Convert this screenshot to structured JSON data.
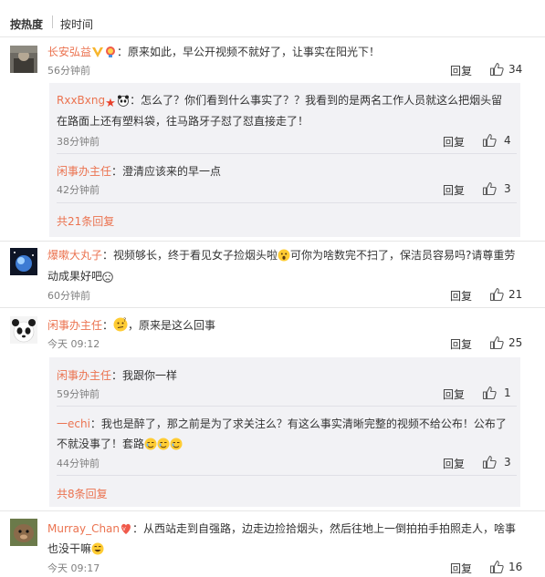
{
  "sort": {
    "hot": "按热度",
    "time": "按时间"
  },
  "labels": {
    "reply": "回复"
  },
  "comments": [
    {
      "user": "长安弘益",
      "text": "：原来如此，早公开视频不就好了，让事实在阳光下！",
      "time": "56分钟前",
      "likes": "34",
      "replies": [
        {
          "user": "RxxBxng",
          "text1": "：怎么了？你们看到什么事实了？？我看到的是两名工作人员就这么把烟头留",
          "text2": "在路面上还有塑料袋，往马路牙子怼了怼直接走了！",
          "time": "38分钟前",
          "likes": "4"
        },
        {
          "user": "闲事办主任",
          "text": "：澄清应该来的早一点",
          "time": "42分钟前",
          "likes": "3"
        }
      ],
      "more": "共21条回复"
    },
    {
      "user": "爆嗽大丸子",
      "text1": "：视频够长，终于看见女子捡烟头啦",
      "text1b": "可你为啥数完不扫了，保洁员容易吗?请尊重劳",
      "text2": "动成果好吧",
      "time": "60分钟前",
      "likes": "21"
    },
    {
      "user": "闲事办主任",
      "text": "，原来是这么回事",
      "time": "今天 09:12",
      "likes": "25",
      "replies": [
        {
          "user": "闲事办主任",
          "text": "：我跟你一样",
          "time": "59分钟前",
          "likes": "1"
        },
        {
          "user": "一echi",
          "text1": "：我也是醉了，那之前是为了求关注么？有这么事实清晰完整的视频不给公布！公布了",
          "text2": "不就没事了！套路",
          "time": "44分钟前",
          "likes": "3"
        }
      ],
      "more": "共8条回复"
    },
    {
      "user": "Murray_Chan",
      "text1": "：从西站走到自强路，边走边捡拾烟头，然后往地上一倒拍拍手拍照走人，啥事",
      "text2": "也没干嘛",
      "time": "今天 09:17",
      "likes": "16"
    }
  ]
}
